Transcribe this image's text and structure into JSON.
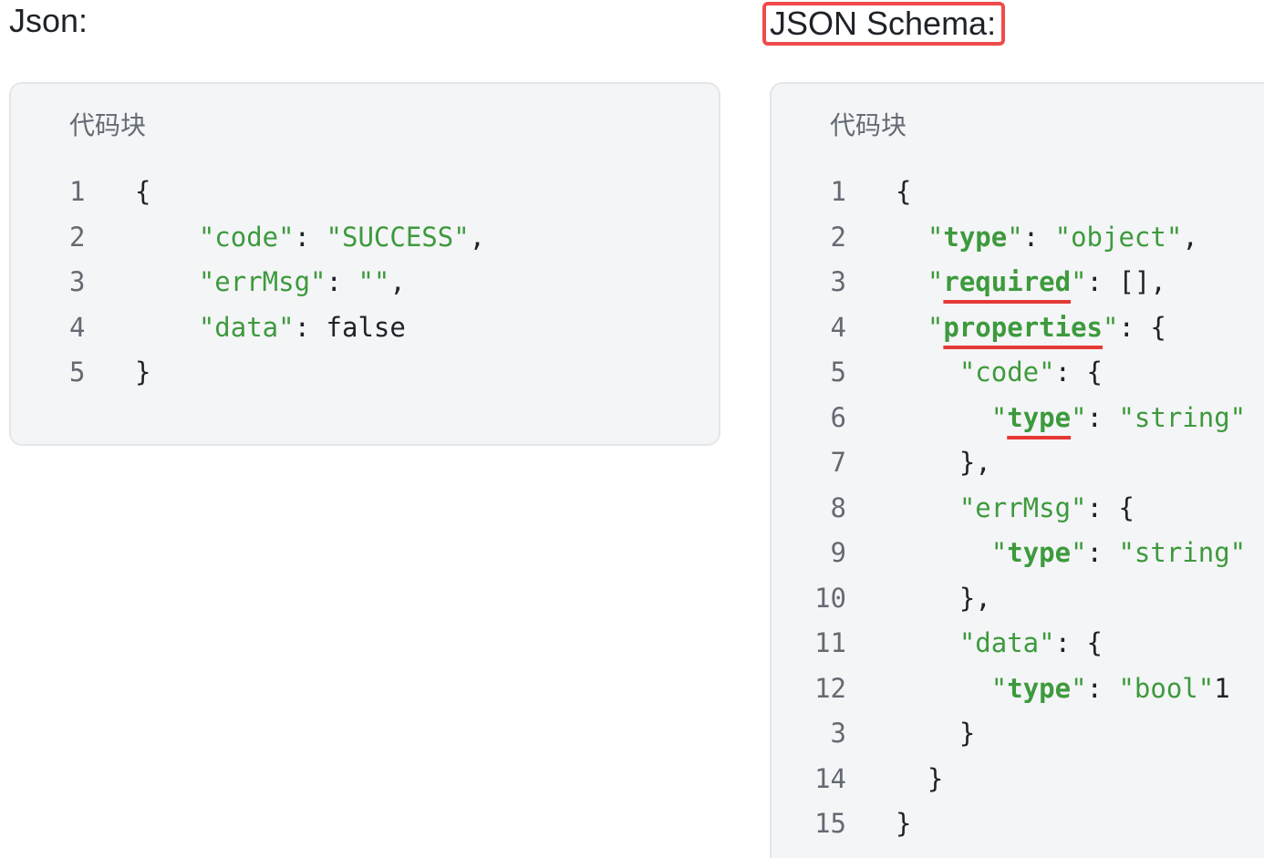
{
  "headings": {
    "json": "Json:",
    "schema": "JSON Schema:"
  },
  "left_block": {
    "label": "代码块",
    "lines": [
      {
        "no": "1"
      },
      {
        "no": "2"
      },
      {
        "no": "3"
      },
      {
        "no": "4"
      },
      {
        "no": "5"
      }
    ],
    "tokens": {
      "open_brace": "{",
      "close_brace": "}",
      "code_key": "\"code\"",
      "code_value": "\"SUCCESS\"",
      "errmsg_key": "\"errMsg\"",
      "errmsg_value": "\"\"",
      "data_key": "\"data\"",
      "data_value": "false"
    }
  },
  "right_block": {
    "label": "代码块",
    "line_numbers": [
      "1",
      "2",
      "3",
      "4",
      "5",
      "6",
      "7",
      "8",
      "9",
      "10",
      "11",
      "12",
      "3",
      "14",
      "15"
    ],
    "tokens": {
      "open_brace": "{",
      "close_brace": "}",
      "type_word": "type",
      "object_value": "\"object\"",
      "required_word": "required",
      "empty_array": "[]",
      "properties_word": "properties",
      "code_key": "\"code\"",
      "string_value": "\"string\"",
      "errmsg_key": "\"errMsg\"",
      "data_key": "\"data\"",
      "bool_value": "\"bool\"",
      "bool_trailing": "1"
    }
  },
  "colors": {
    "accent_red": "#ef4b4b",
    "string_green": "#3d9a3d",
    "block_bg": "#f4f5f6"
  }
}
